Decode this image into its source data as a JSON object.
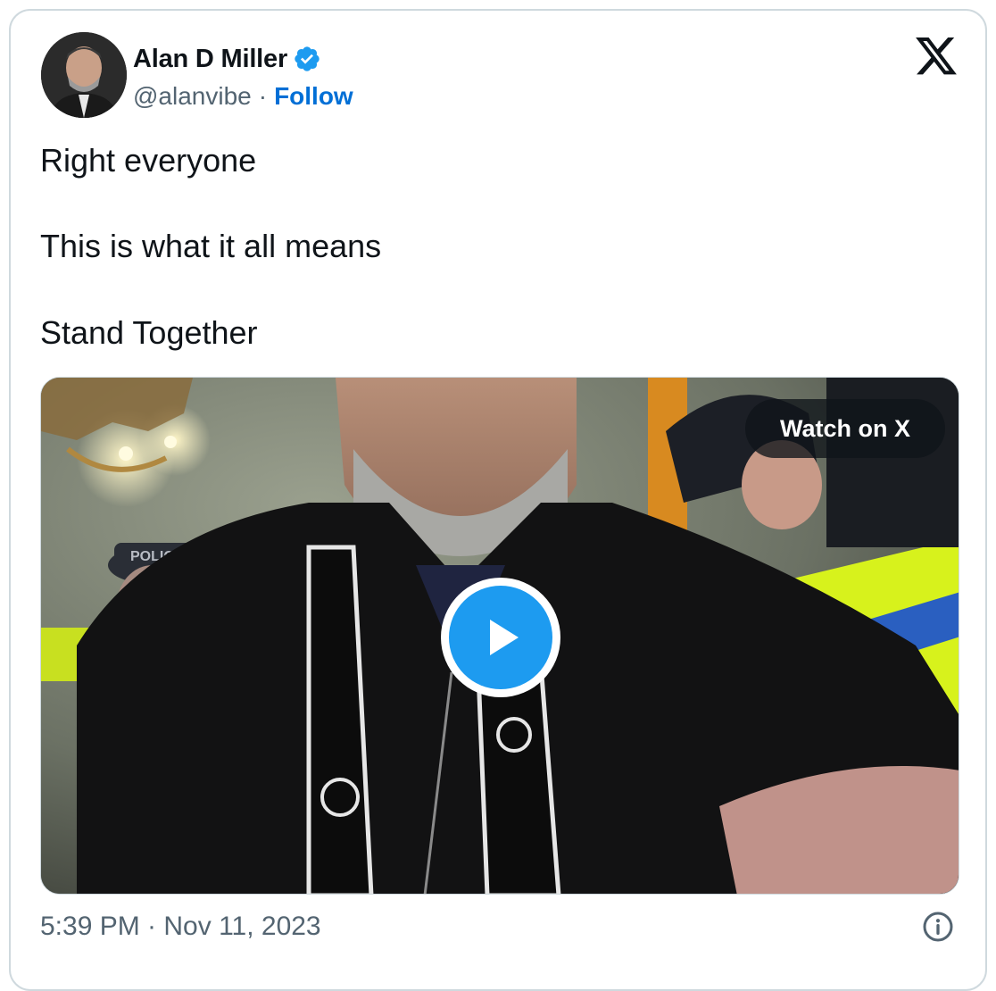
{
  "author": {
    "name": "Alan D Miller",
    "handle": "@alanvibe",
    "separator": "·",
    "follow_label": "Follow",
    "verified_icon": "verified-badge-icon",
    "avatar_icon": "profile-photo"
  },
  "platform": {
    "logo": "x-logo-icon"
  },
  "tweet": {
    "lines": [
      "Right everyone",
      "This is what it all means",
      "Stand Together"
    ]
  },
  "media": {
    "watch_label": "Watch on X",
    "play_icon": "play-icon",
    "police_badge_text": "POLICE"
  },
  "footer": {
    "timestamp": "5:39 PM · Nov 11, 2023",
    "info_icon": "info-icon"
  },
  "colors": {
    "accent": "#1d9bf0",
    "follow_link": "#006fd6",
    "secondary_text": "#536471",
    "border": "#cfd9de",
    "hi_vis": "#d7f21c"
  }
}
